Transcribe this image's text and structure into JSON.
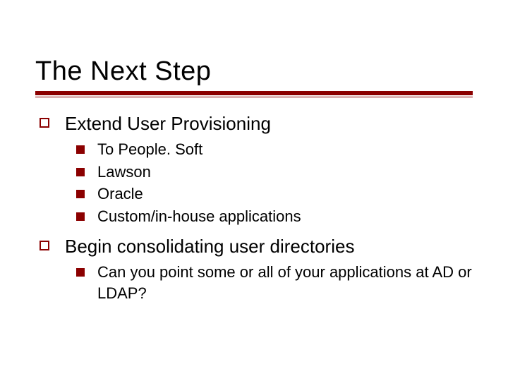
{
  "title": "The Next Step",
  "bullets": [
    {
      "text": "Extend User Provisioning",
      "children": [
        {
          "text": "To People. Soft"
        },
        {
          "text": "Lawson"
        },
        {
          "text": "Oracle"
        },
        {
          "text": "Custom/in-house applications"
        }
      ]
    },
    {
      "text": "Begin consolidating user directories",
      "children": [
        {
          "text": "Can you point some or all of your applications at AD or LDAP?"
        }
      ]
    }
  ],
  "colors": {
    "accent": "#8b0000"
  }
}
